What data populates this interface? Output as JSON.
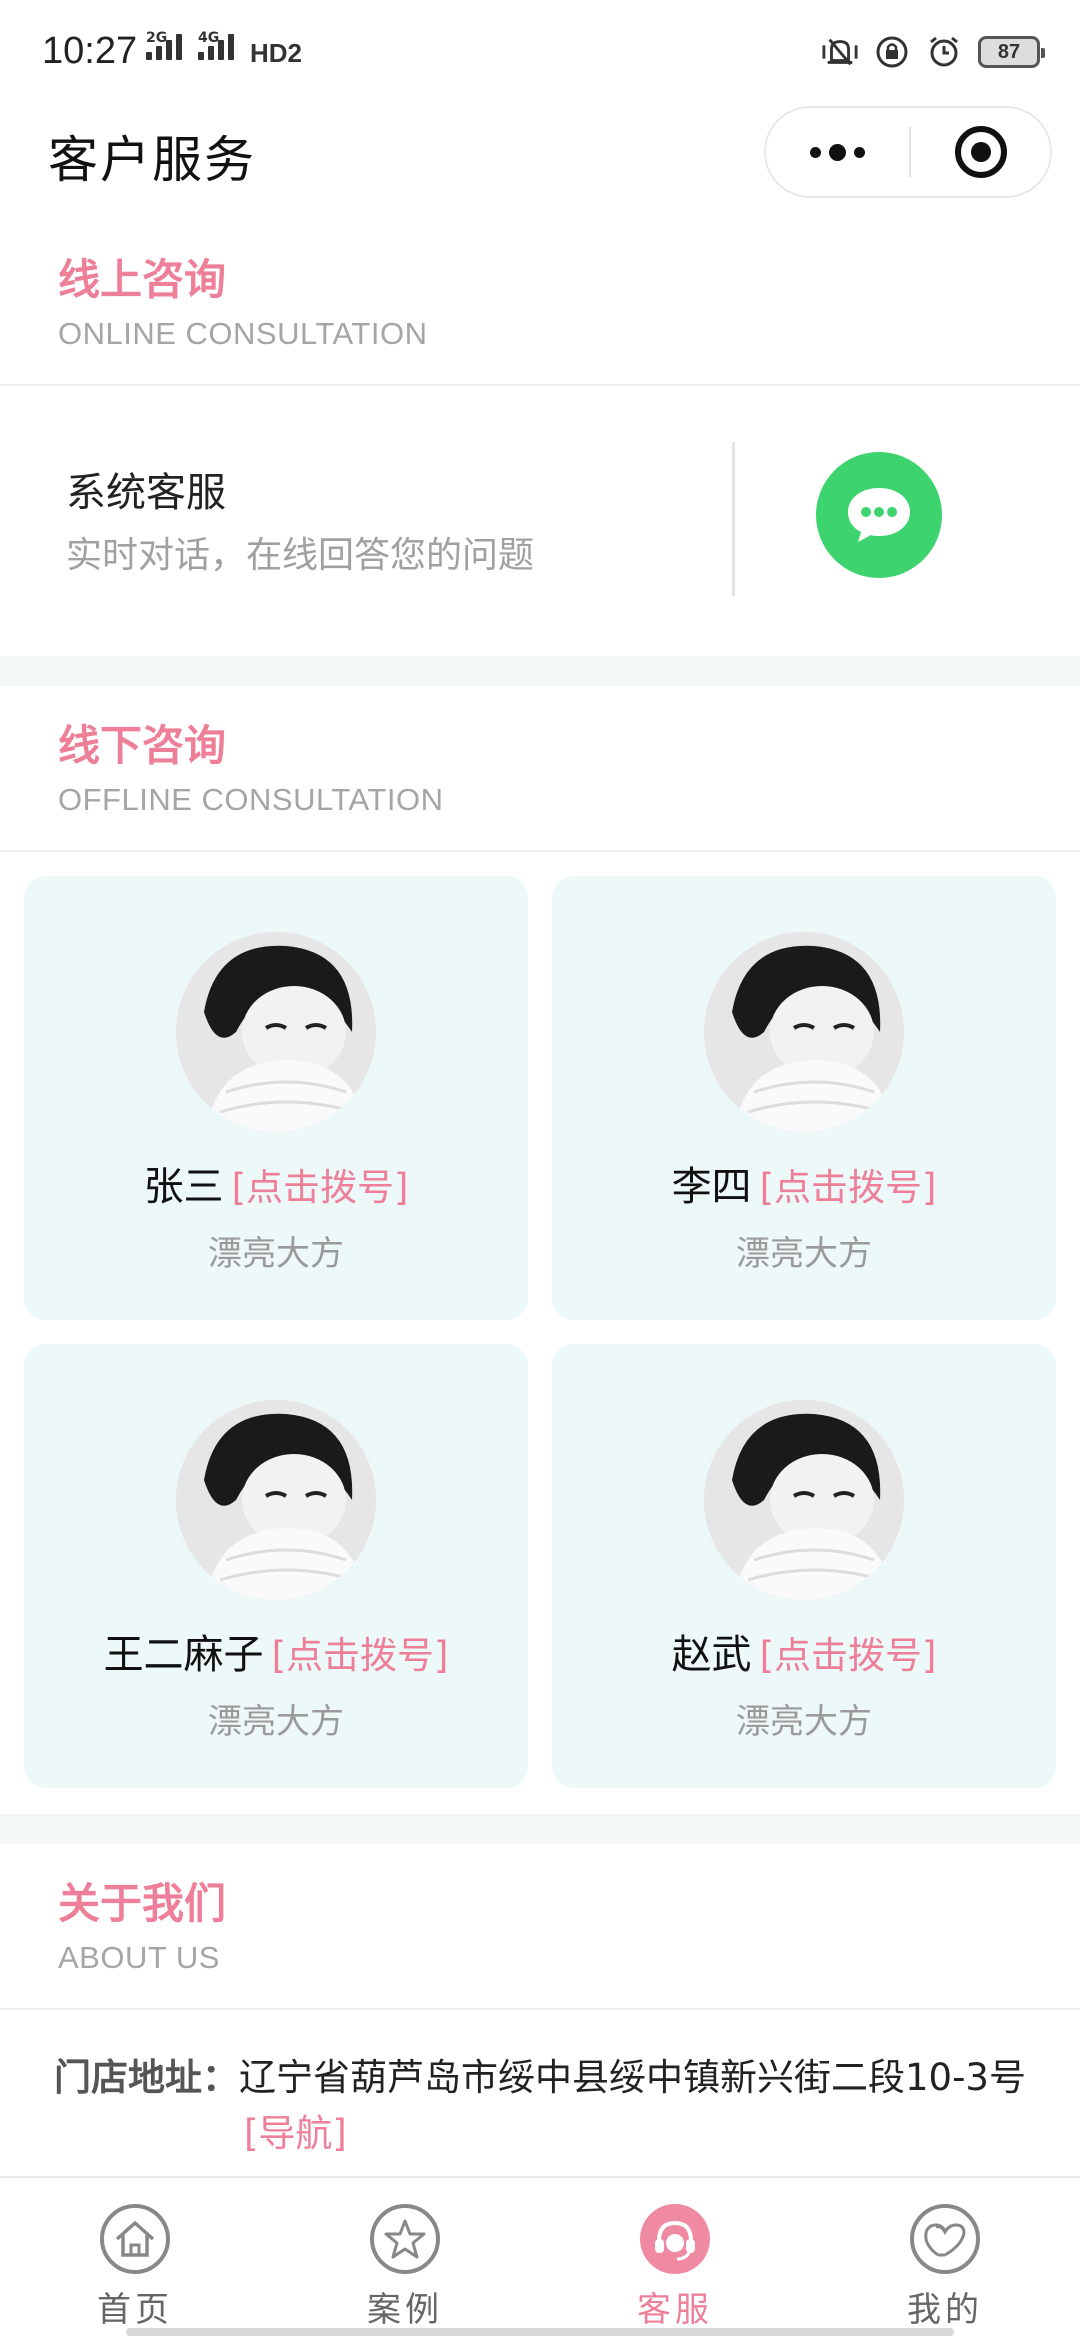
{
  "status_bar": {
    "time": "10:27",
    "network1": "2G",
    "network2": "4G",
    "hd": "HD2",
    "battery": "87"
  },
  "nav": {
    "title": "客户服务"
  },
  "online": {
    "title": "线上咨询",
    "subtitle": "ONLINE CONSULTATION",
    "service_name": "系统客服",
    "service_desc": "实时对话，在线回答您的问题",
    "chat_icon": "chat-bubble-icon",
    "chat_color": "#3dd36f"
  },
  "offline": {
    "title": "线下咨询",
    "subtitle": "OFFLINE CONSULTATION",
    "contacts": [
      {
        "name": "张三",
        "dial": "[点击拨号]",
        "desc": "漂亮大方"
      },
      {
        "name": "李四",
        "dial": "[点击拨号]",
        "desc": "漂亮大方"
      },
      {
        "name": "王二麻子",
        "dial": "[点击拨号]",
        "desc": "漂亮大方"
      },
      {
        "name": "赵武",
        "dial": "[点击拨号]",
        "desc": "漂亮大方"
      }
    ]
  },
  "about": {
    "title": "关于我们",
    "subtitle": "ABOUT US",
    "address_label": "门店地址：",
    "address": "辽宁省葫芦岛市绥中县绥中镇新兴街二段10-3号",
    "nav_link": "[导航]"
  },
  "tabbar": {
    "items": [
      {
        "label": "首页",
        "icon": "home-icon"
      },
      {
        "label": "案例",
        "icon": "star-icon"
      },
      {
        "label": "客服",
        "icon": "customer-service-icon"
      },
      {
        "label": "我的",
        "icon": "heart-icon"
      }
    ],
    "active_index": 2
  },
  "colors": {
    "accent": "#ee7f99",
    "card_bg": "#edf8f8",
    "muted": "#a5a5a5"
  }
}
